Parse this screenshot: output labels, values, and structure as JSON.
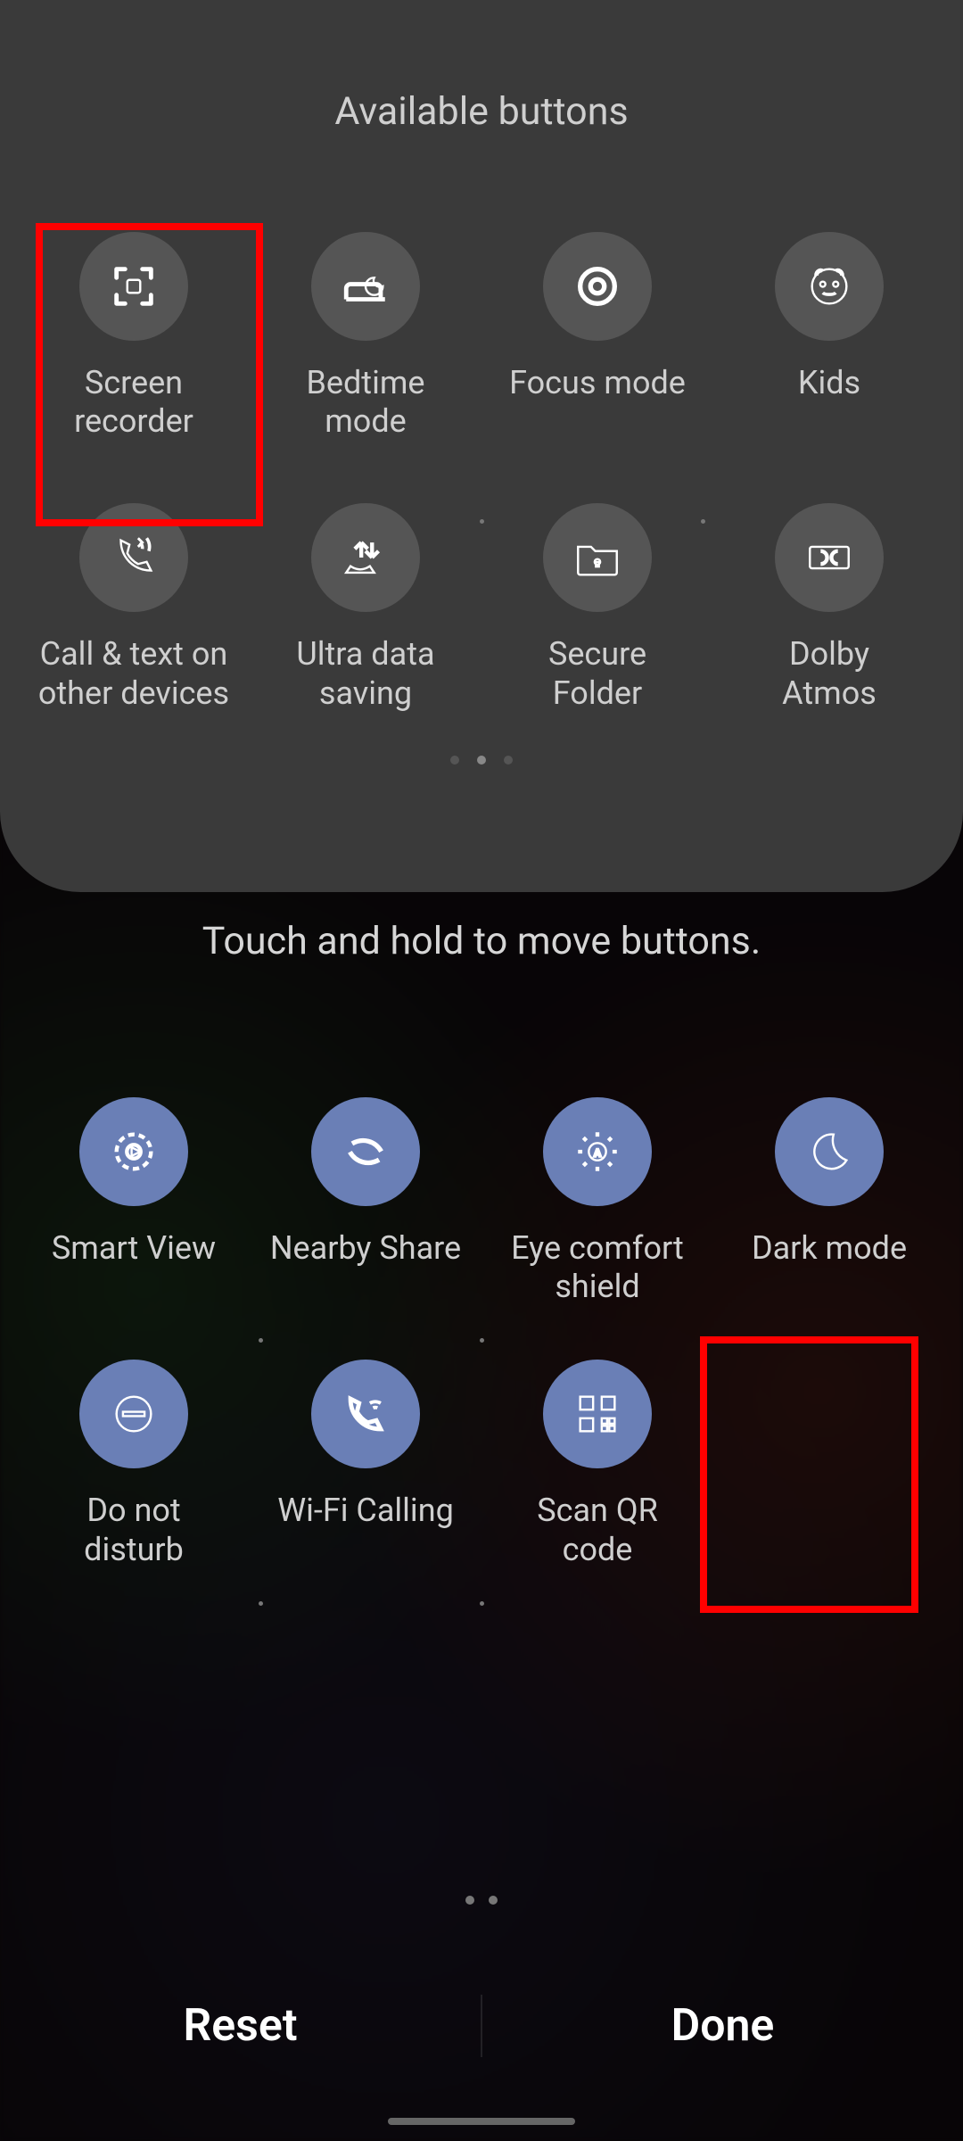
{
  "header": {
    "title": "Available buttons"
  },
  "available": [
    {
      "key": "screen-recorder",
      "label": "Screen\nrecorder",
      "icon": "screen-recorder"
    },
    {
      "key": "bedtime-mode",
      "label": "Bedtime\nmode",
      "icon": "bedtime"
    },
    {
      "key": "focus-mode",
      "label": "Focus mode",
      "icon": "focus"
    },
    {
      "key": "kids",
      "label": "Kids",
      "icon": "kids"
    },
    {
      "key": "call-text-devices",
      "label": "Call & text on\nother devices",
      "icon": "call-devices"
    },
    {
      "key": "ultra-data-saving",
      "label": "Ultra data\nsaving",
      "icon": "data-saving"
    },
    {
      "key": "secure-folder",
      "label": "Secure\nFolder",
      "icon": "secure-folder"
    },
    {
      "key": "dolby-atmos",
      "label": "Dolby\nAtmos",
      "icon": "dolby"
    }
  ],
  "available_page_dots": {
    "count": 3,
    "active": 1
  },
  "hint": "Touch and hold to move buttons.",
  "panel": [
    {
      "key": "smart-view",
      "label": "Smart View",
      "icon": "smart-view"
    },
    {
      "key": "nearby-share",
      "label": "Nearby Share",
      "icon": "nearby-share"
    },
    {
      "key": "eye-comfort",
      "label": "Eye comfort\nshield",
      "icon": "eye-comfort"
    },
    {
      "key": "dark-mode",
      "label": "Dark mode",
      "icon": "dark-mode"
    },
    {
      "key": "dnd",
      "label": "Do not\ndisturb",
      "icon": "dnd"
    },
    {
      "key": "wifi-calling",
      "label": "Wi-Fi Calling",
      "icon": "wifi-calling"
    },
    {
      "key": "scan-qr",
      "label": "Scan QR\ncode",
      "icon": "qr"
    },
    {
      "key": "empty-slot",
      "label": "",
      "icon": null
    }
  ],
  "panel_page_dots": {
    "count": 2,
    "active": 1
  },
  "footer": {
    "reset": "Reset",
    "done": "Done"
  }
}
